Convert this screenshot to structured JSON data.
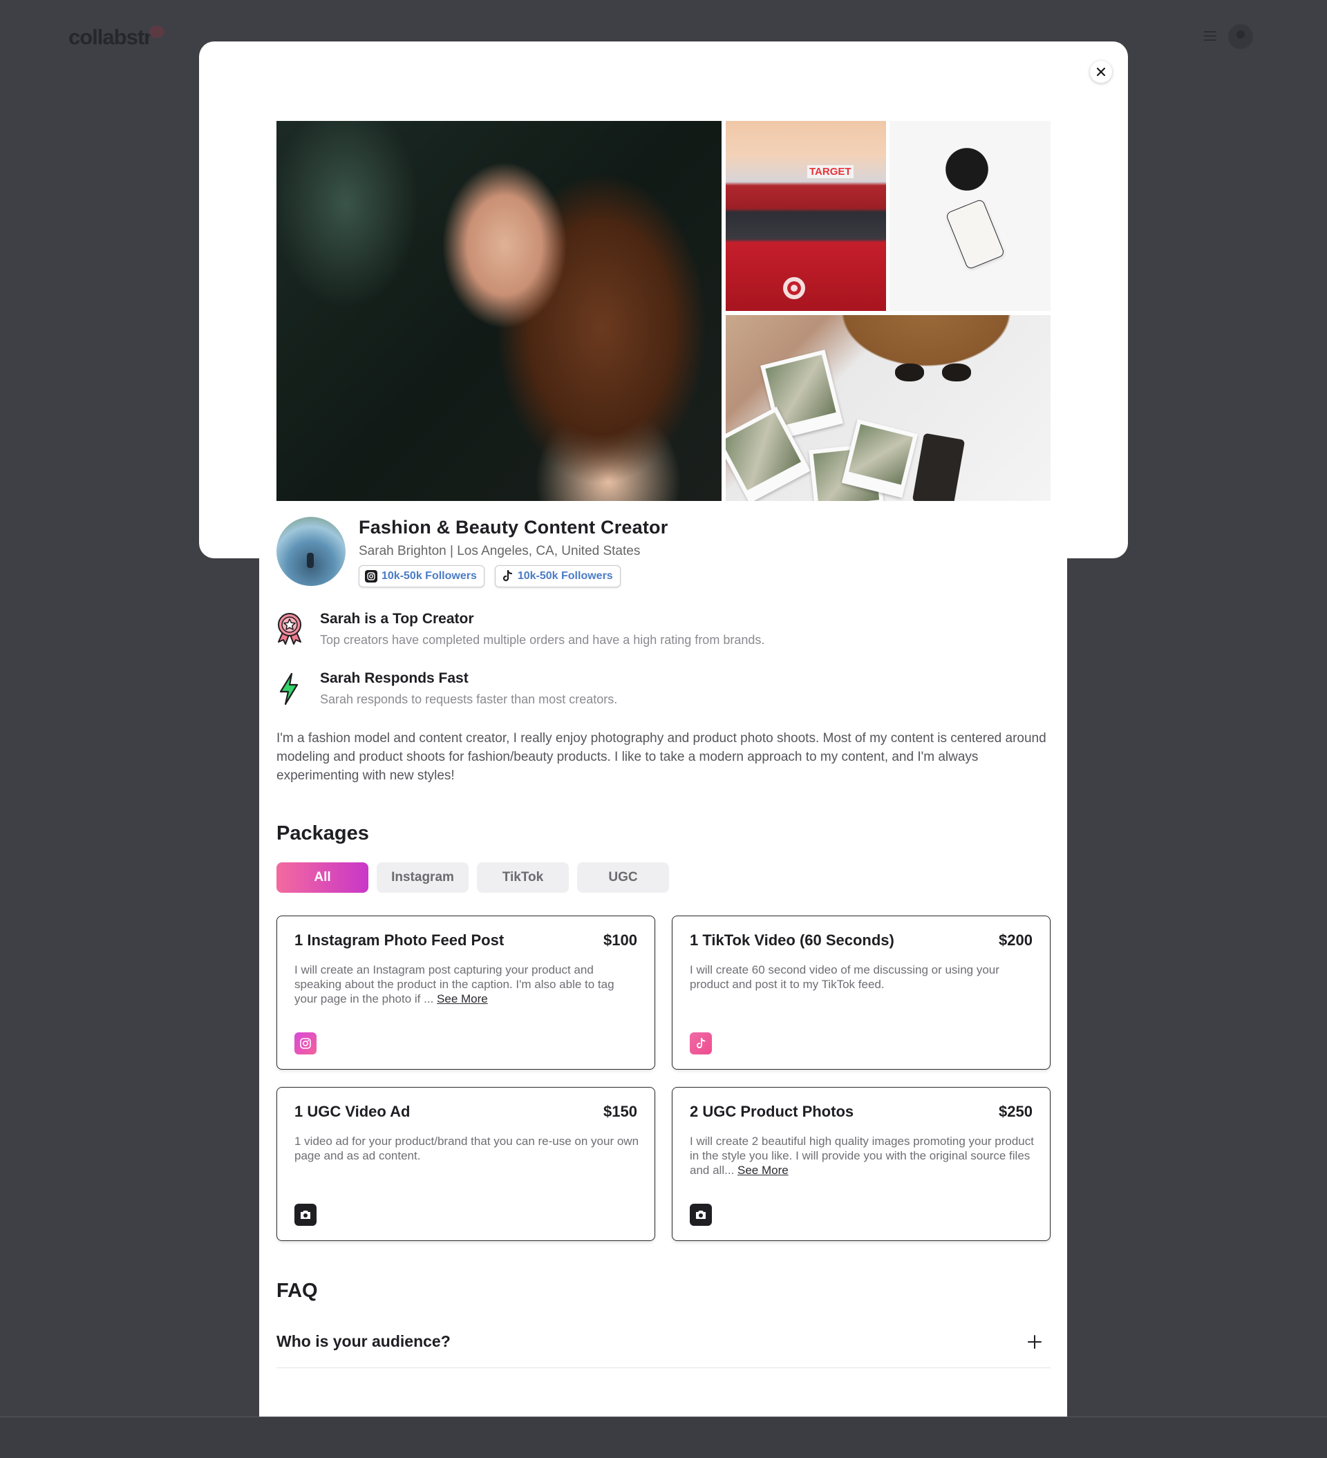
{
  "app": {
    "logo_text": "collabstr"
  },
  "profile": {
    "title": "Fashion & Beauty Content Creator",
    "subtitle": "Sarah Brighton | Los Angeles, CA, United States",
    "badges": [
      {
        "platform_icon": "instagram-icon",
        "label": "10k-50k Followers"
      },
      {
        "platform_icon": "tiktok-icon",
        "label": "10k-50k Followers"
      }
    ]
  },
  "gallery": {
    "target_sign": "TARGET",
    "photos": [
      "portrait-photo",
      "shopping-cart-photo",
      "coffee-plant-photo",
      "flatlay-photo"
    ]
  },
  "features": [
    {
      "icon": "award-ribbon-icon",
      "title": "Sarah is a Top Creator",
      "desc": "Top creators have completed multiple orders and have a high rating from brands."
    },
    {
      "icon": "lightning-bolt-icon",
      "title": "Sarah Responds Fast",
      "desc": "Sarah responds to requests faster than most creators."
    }
  ],
  "bio": "I'm a fashion model and content creator, I really enjoy photography and product photo shoots. Most of my content is centered around modeling and product shoots for fashion/beauty products. I like to take a modern approach to my content, and I'm always experimenting with new styles!",
  "packages": {
    "heading": "Packages",
    "tabs": [
      {
        "label": "All",
        "active": true
      },
      {
        "label": "Instagram",
        "active": false
      },
      {
        "label": "TikTok",
        "active": false
      },
      {
        "label": "UGC",
        "active": false
      }
    ],
    "items": [
      {
        "title": "1 Instagram Photo Feed Post",
        "price": "$100",
        "desc": "I will create an Instagram post capturing your product and speaking about the product in the caption. I'm also able to tag your page in the photo if ... ",
        "see_more": "See More",
        "icon": "instagram-icon"
      },
      {
        "title": "1 TikTok Video (60 Seconds)",
        "price": "$200",
        "desc": "I will create 60 second video of me discussing or using your product and post it to my TikTok feed.",
        "see_more": "",
        "icon": "tiktok-icon"
      },
      {
        "title": "1 UGC Video Ad",
        "price": "$150",
        "desc": "1 video ad for your product/brand that you can re-use on your own page and as ad content.",
        "see_more": "",
        "icon": "camera-icon"
      },
      {
        "title": "2 UGC Product Photos",
        "price": "$250",
        "desc": "I will create 2 beautiful high quality images promoting your product in the style you like. I will provide you with the original source files and all... ",
        "see_more": "See More",
        "icon": "camera-icon"
      }
    ]
  },
  "faq": {
    "heading": "FAQ",
    "items": [
      {
        "question": "Who is your audience?"
      }
    ]
  },
  "colors": {
    "accent_gradient_start": "#f46a9e",
    "accent_gradient_end": "#c837c8",
    "follower_text": "#4b7cc6",
    "overlay": "#3f4046"
  }
}
